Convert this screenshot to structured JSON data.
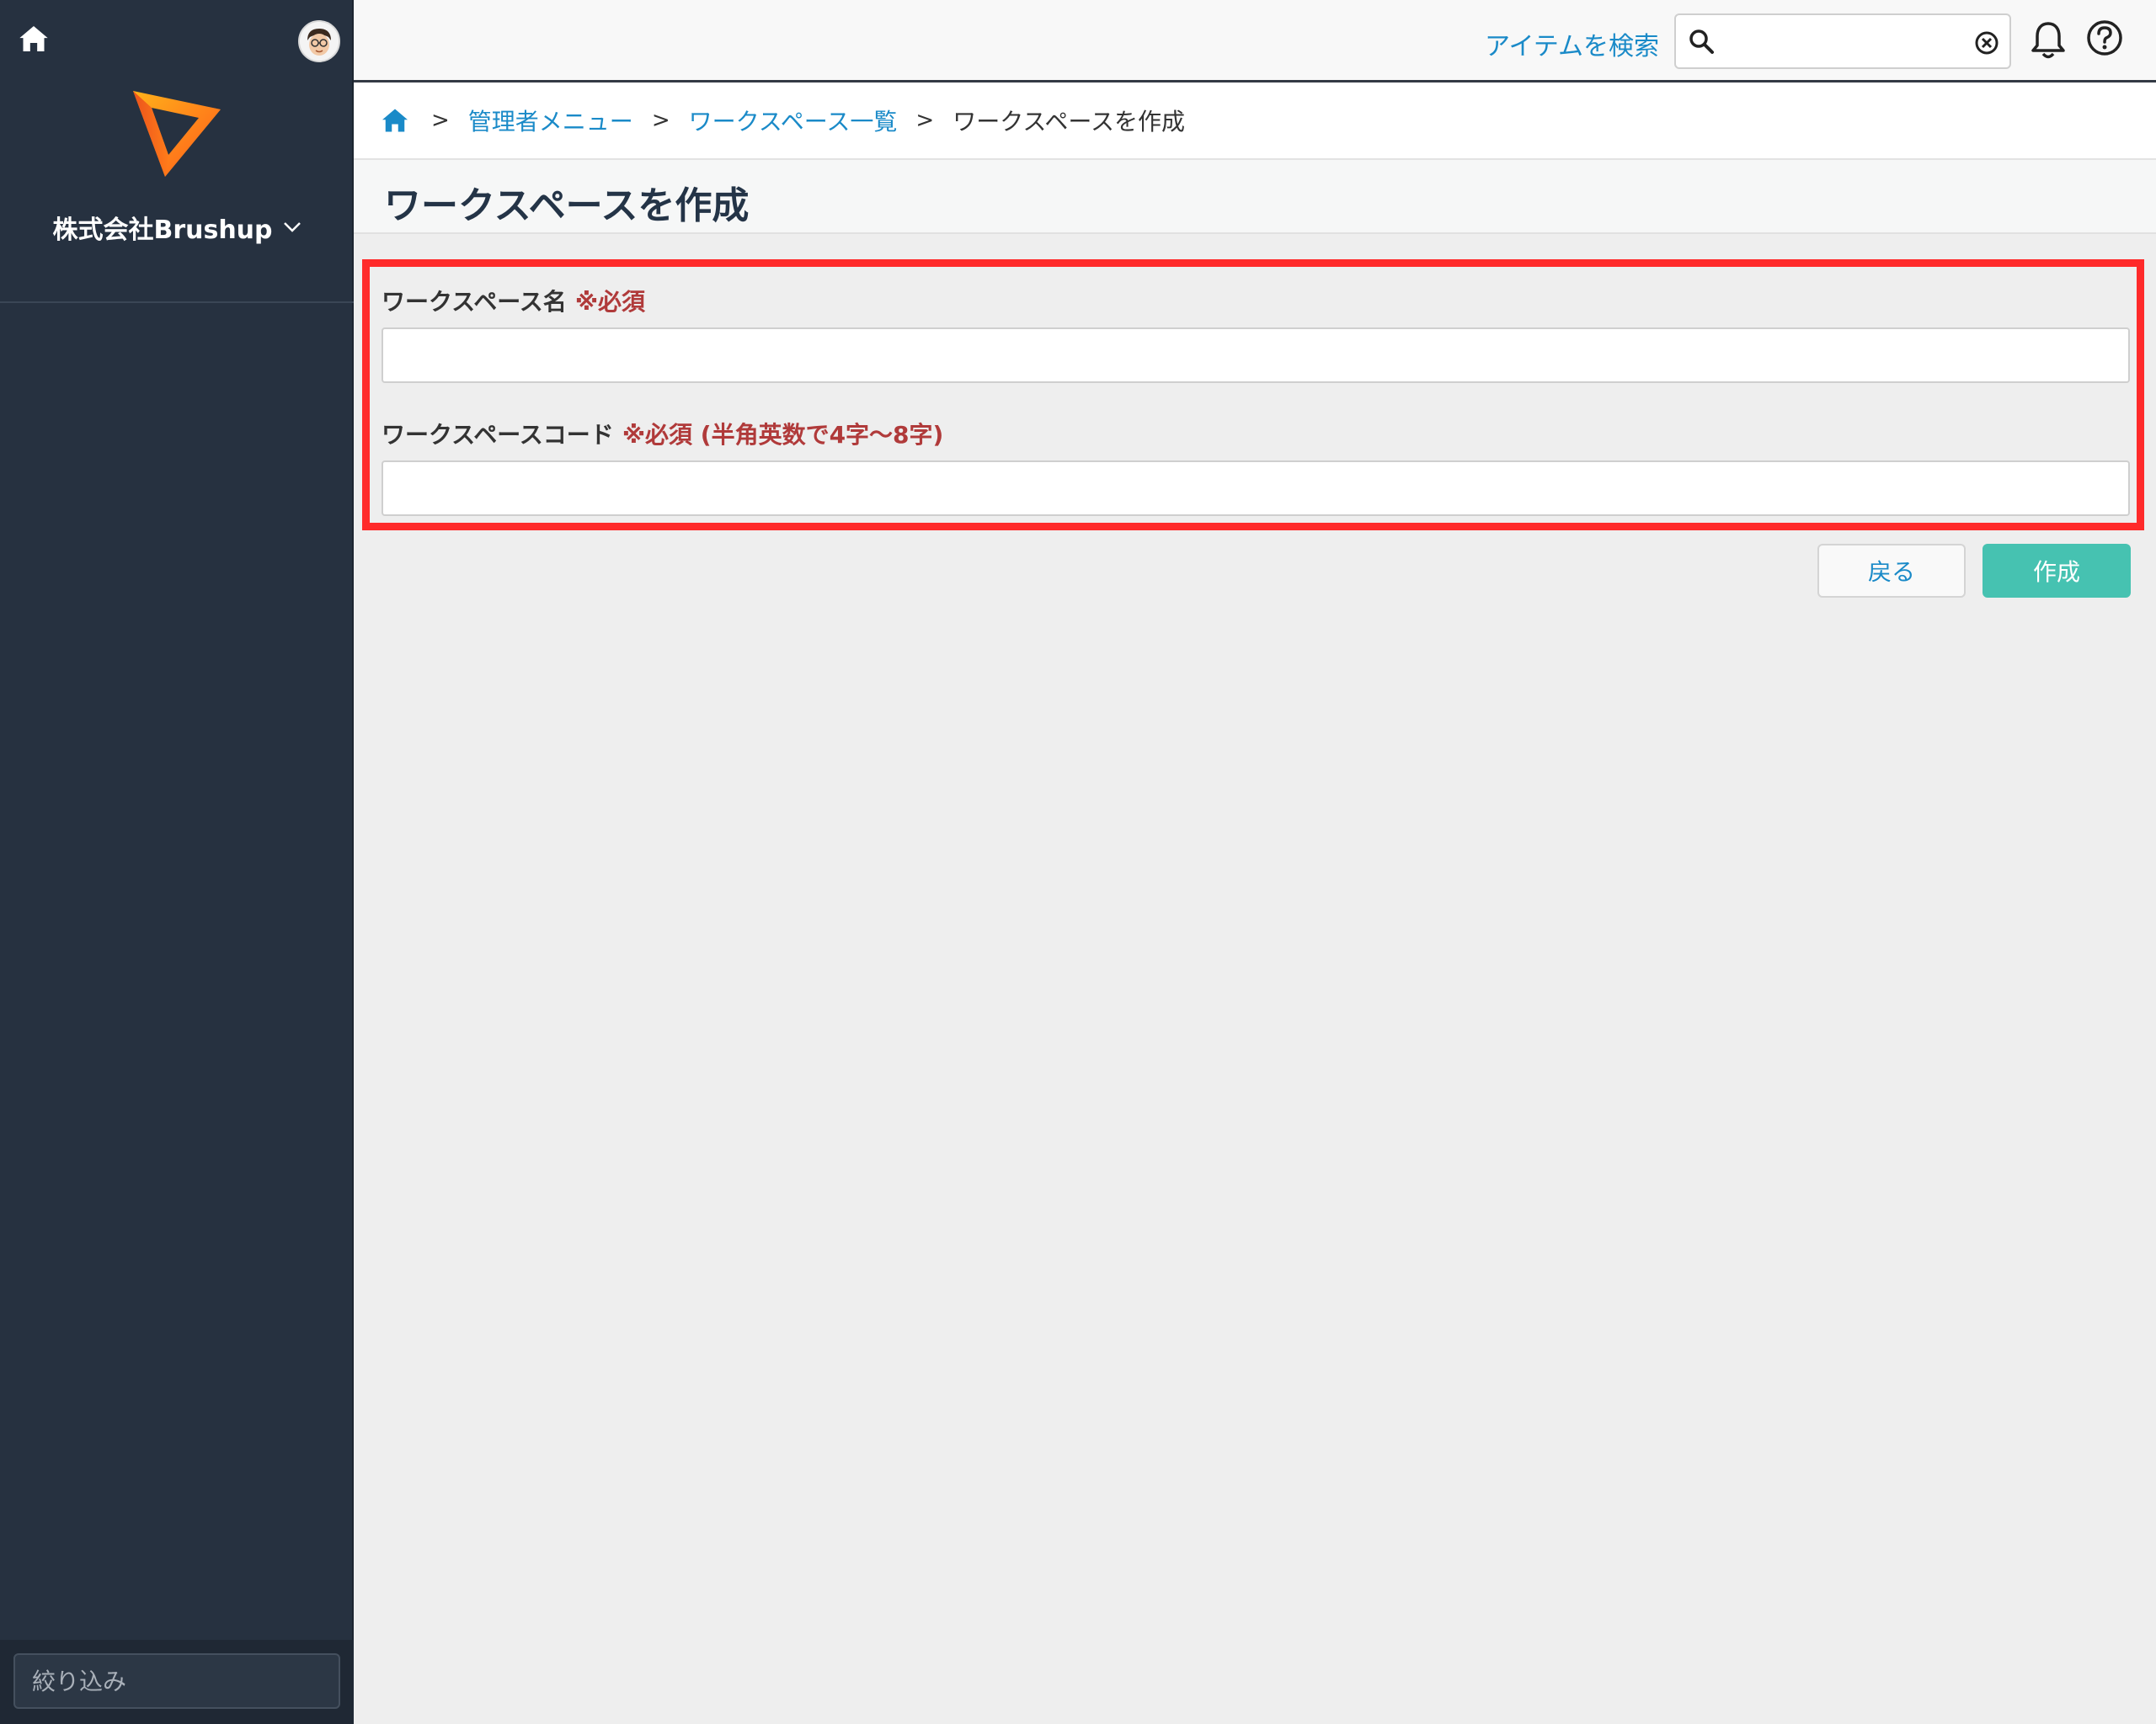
{
  "sidebar": {
    "company_name": "株式会社Brushup",
    "filter_placeholder": "絞り込み"
  },
  "topbar": {
    "search_label": "アイテムを検索",
    "search_value": ""
  },
  "breadcrumb": {
    "items": [
      "管理者メニュー",
      "ワークスペース一覧"
    ],
    "current": "ワークスペースを作成",
    "separator": ">"
  },
  "page": {
    "title": "ワークスペースを作成"
  },
  "form": {
    "name_label": "ワークスペース名",
    "name_required": "※必須",
    "name_value": "",
    "code_label": "ワークスペースコード",
    "code_required": "※必須 (半角英数で4字〜8字)",
    "code_value": ""
  },
  "buttons": {
    "back": "戻る",
    "create": "作成"
  },
  "colors": {
    "sidebar_bg": "#263140",
    "link": "#1a8ac8",
    "primary_button": "#46c2b1",
    "required_text": "#b03a3a",
    "highlight_border": "#ff2a2a"
  }
}
